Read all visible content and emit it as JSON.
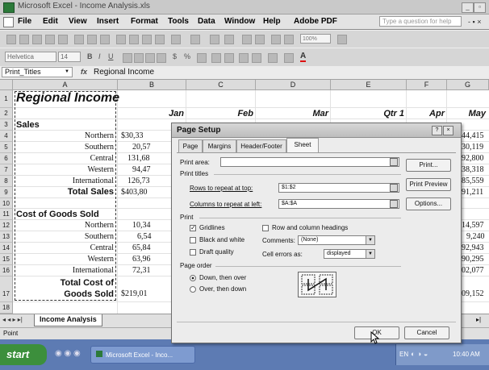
{
  "window": {
    "title": "Microsoft Excel - Income Analysis.xls"
  },
  "menu": {
    "items": [
      "File",
      "Edit",
      "View",
      "Insert",
      "Format",
      "Tools",
      "Data",
      "Window",
      "Help",
      "Adobe PDF"
    ],
    "ask_placeholder": "Type a question for help"
  },
  "toolbar": {
    "zoom": "100%",
    "font_name": "Helvetica",
    "font_size": "14"
  },
  "formula": {
    "name_box": "Print_Titles",
    "fx": "fx",
    "content": "Regional Income"
  },
  "grid": {
    "columns": [
      "A",
      "B",
      "C",
      "D",
      "E",
      "F",
      "G"
    ],
    "rows": [
      "1",
      "2",
      "3",
      "4",
      "5",
      "6",
      "7",
      "8",
      "9",
      "10",
      "11",
      "12",
      "13",
      "14",
      "15",
      "16",
      "17",
      "18"
    ],
    "title": "Regional Income",
    "month_headers": [
      "Jan",
      "Feb",
      "Mar",
      "Qtr 1",
      "Apr",
      "May"
    ],
    "sales_label": "Sales",
    "regions": [
      "Northern",
      "Southern",
      "Central",
      "Western",
      "International"
    ],
    "total_sales_label": "Total Sales",
    "cogs_label": "Cost of Goods Sold",
    "total_cogs_label_1": "Total Cost of",
    "total_cogs_label_2": "Goods Sold",
    "b_sales": [
      "$30,33",
      "20,57",
      "131,68",
      "94,47",
      "126,73"
    ],
    "b_total_sales": "$403,80",
    "g_sales": [
      "44,415",
      "30,119",
      "92,800",
      "38,318",
      "85,559"
    ],
    "g_total_sales": "91,211",
    "b_cogs": [
      "10,34",
      "6,54",
      "65,84",
      "63,96",
      "72,31"
    ],
    "b_total_cogs": "$219,01",
    "g_cogs": [
      "14,597",
      "9,240",
      "92,943",
      "90,295",
      "02,077"
    ],
    "g_total_cogs": "09,152"
  },
  "sheet_tabs": {
    "active": "Income Analysis"
  },
  "status": {
    "text": "Point"
  },
  "taskbar": {
    "start": "start",
    "app": "Microsoft Excel - Inco...",
    "tray_lang": "EN",
    "time": "10:40 AM"
  },
  "dialog": {
    "title": "Page Setup",
    "tabs": [
      "Page",
      "Margins",
      "Header/Footer",
      "Sheet"
    ],
    "active_tab": "Sheet",
    "print_area_label": "Print area:",
    "print_area_value": "",
    "print_titles_label": "Print titles",
    "rows_repeat_label": "Rows to repeat at top:",
    "rows_repeat_value": "$1:$2",
    "cols_repeat_label": "Columns to repeat at left:",
    "cols_repeat_value": "$A:$A",
    "print_label": "Print",
    "gridlines": "Gridlines",
    "black_white": "Black and white",
    "draft": "Draft quality",
    "row_col_headings": "Row and column headings",
    "comments_label": "Comments:",
    "comments_value": "(None)",
    "cell_errors_label": "Cell errors as:",
    "cell_errors_value": "displayed",
    "page_order_label": "Page order",
    "down_over": "Down, then over",
    "over_down": "Over, then down",
    "btn_print": "Print...",
    "btn_preview": "Print Preview",
    "btn_options": "Options...",
    "btn_ok": "OK",
    "btn_cancel": "Cancel"
  }
}
